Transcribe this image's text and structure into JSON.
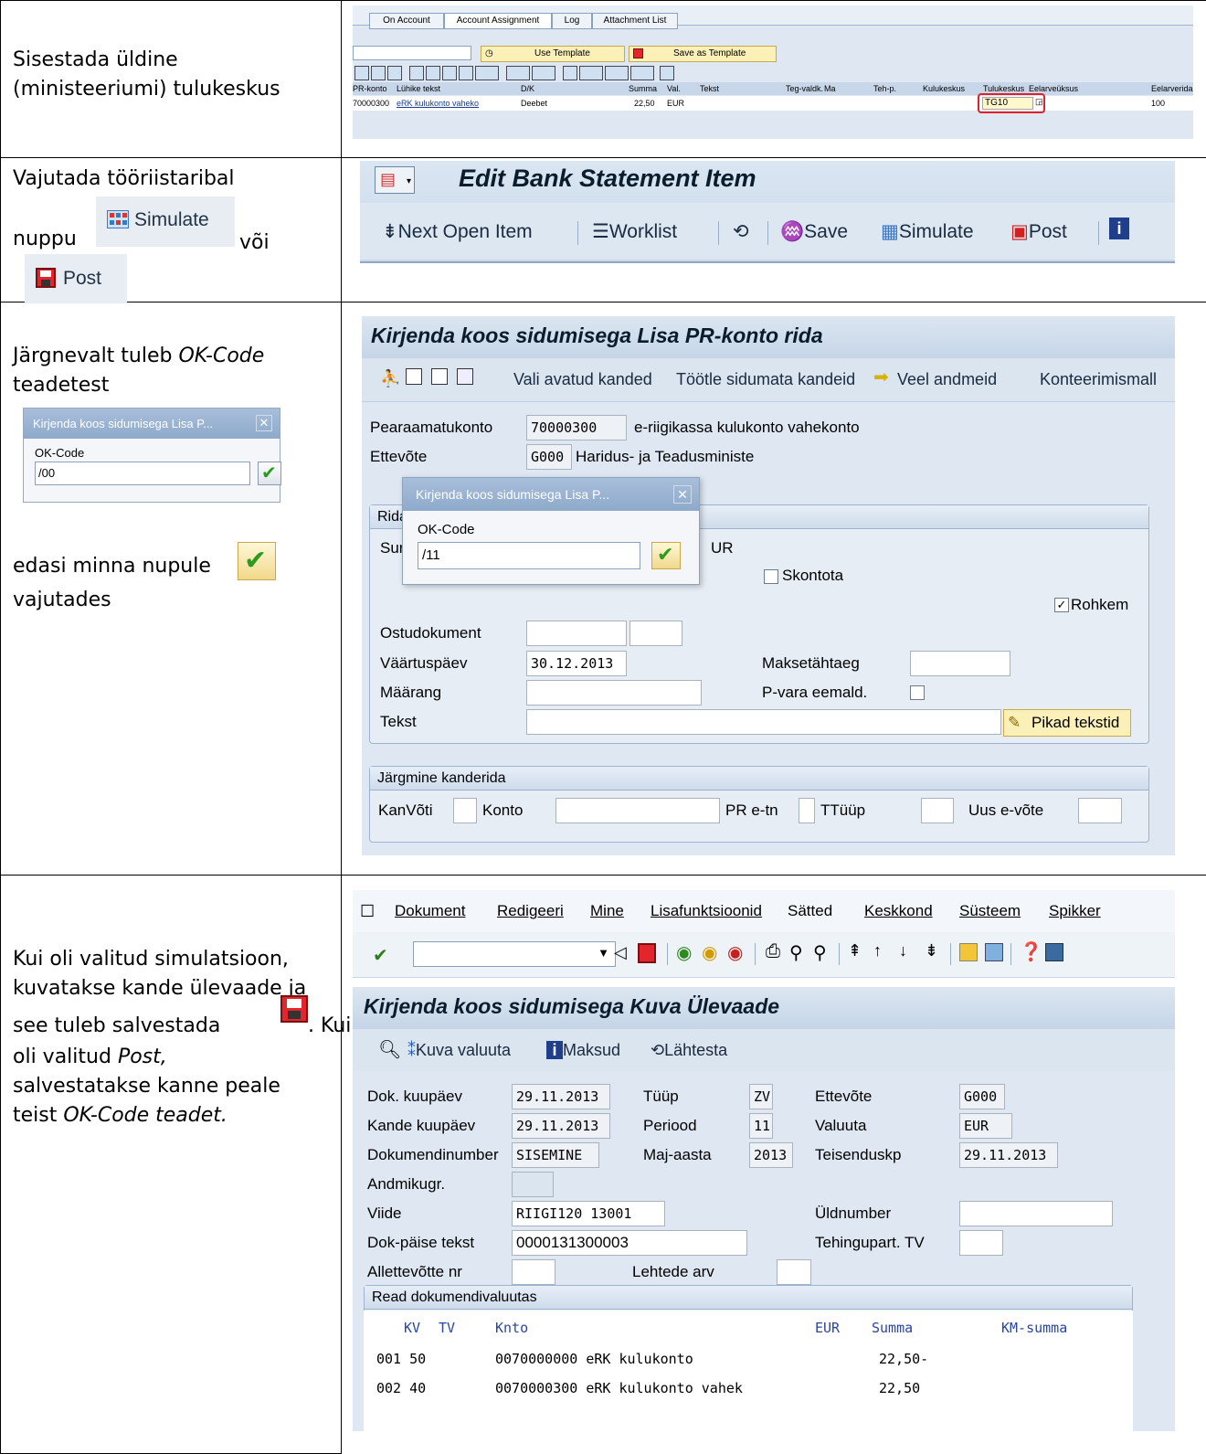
{
  "rows": [
    {
      "instruction": [
        "Sisestada üldine",
        "(ministeeriumi) tulukeskus"
      ]
    },
    {
      "instruction_parts": {
        "line1": "Vajutada tööriistaribal",
        "nuppu": "nuppu",
        "voi": "või",
        "simulate": "Simulate",
        "post": "Post"
      }
    },
    {
      "instruction_parts": {
        "p1": "Järgnevalt tuleb ",
        "okcode": "OK-Code",
        "p2": "teadetest",
        "p3": "edasi minna nupule",
        "p4": "vajutades"
      }
    },
    {
      "instruction_parts": {
        "l1": "Kui oli valitud simulatsioon,",
        "l2": "kuvatakse kande ülevaade ja",
        "l3a": "see tuleb salvestada",
        "l3b": ". Kui",
        "l4a": "oli valitud ",
        "l4b": "Post,",
        "l5": "salvestatakse kanne peale",
        "l6a": "teist ",
        "l6b": "OK-Code teadet."
      }
    }
  ],
  "screen1": {
    "tabs": [
      "On Account",
      "Account Assignment",
      "Log",
      "Attachment List"
    ],
    "use_template": "Use Template",
    "save_as_template": "Save as Template",
    "headers": [
      "PR-konto",
      "Lühike tekst",
      "D/K",
      "Summa",
      "Val.",
      "Tekst",
      "Teg-valdk.",
      "Ma",
      "Teh-p.",
      "Kulukeskus",
      "Tulukeskus",
      "Eelarveüksus",
      "Eelarverida"
    ],
    "row": {
      "konto": "70000300",
      "tekst": "eRK kulukonto vaheko",
      "dk": "Deebet",
      "summa": "22,50",
      "val": "EUR",
      "tulukeskus": "TG10",
      "eelarverida": "100"
    }
  },
  "screen2": {
    "title": "Edit Bank Statement Item",
    "buttons": [
      "Next Open Item",
      "Worklist",
      "Save",
      "Simulate",
      "Post"
    ]
  },
  "popup_small": {
    "title": "Kirjenda koos sidumisega Lisa P...",
    "label": "OK-Code",
    "value": "/00"
  },
  "screen3": {
    "title": "Kirjenda koos sidumisega Lisa PR-konto rida",
    "toolbar": [
      "Vali avatud kanded",
      "Töötle sidumata kandeid",
      "Veel andmeid",
      "Konteerimismall"
    ],
    "pearaamatukonto_label": "Pearaamatukonto",
    "pearaamatukonto_value": "70000300",
    "pearaamatukonto_text": "e-riigikassa kulukonto vahekonto",
    "ettevote_label": "Ettevõte",
    "ettevote_value": "G000",
    "ettevote_text": "Haridus- ja Teadusministe",
    "group_head_partial": "Rida",
    "sum_partial": "Sur",
    "cur_partial": "UR",
    "skontota": "Skontota",
    "rohkem": "Rohkem",
    "ostudokument": "Ostudokument",
    "vaartuspaev": "Väärtuspäev",
    "vaartuspaev_value": "30.12.2013",
    "maksetahtaeg": "Maksetähtaeg",
    "maarang": "Määrang",
    "pvara": "P-vara eemald.",
    "tekst": "Tekst",
    "pikad": "Pikad tekstid",
    "next_group": "Järgmine kanderida",
    "kanvoti": "KanVõti",
    "konto": "Konto",
    "pr_etn": "PR e-tn",
    "ttuup": "TTüüp",
    "uus": "Uus e-võte",
    "popup": {
      "title": "Kirjenda koos sidumisega Lisa P...",
      "label": "OK-Code",
      "value": "/11"
    }
  },
  "screen4": {
    "menu": [
      "Dokument",
      "Redigeeri",
      "Mine",
      "Lisafunktsioonid",
      "Sätted",
      "Keskkond",
      "Süsteem",
      "Spikker"
    ],
    "title": "Kirjenda koos sidumisega Kuva Ülevaade",
    "toolbar": [
      "Kuva valuuta",
      "Maksud",
      "Lähtesta"
    ],
    "fields": {
      "dok_kuupaev": "Dok. kuupäev",
      "dok_kuupaev_v": "29.11.2013",
      "tuup": "Tüüp",
      "tuup_v": "ZV",
      "ettevote": "Ettevõte",
      "ettevote_v": "G000",
      "kande_kuupaev": "Kande kuupäev",
      "kande_kuupaev_v": "29.11.2013",
      "periood": "Periood",
      "periood_v": "11",
      "valuuta": "Valuuta",
      "valuuta_v": "EUR",
      "dokumendinumber": "Dokumendinumber",
      "dokumendinumber_v": "SISEMINE",
      "maj_aasta": "Maj-aasta",
      "maj_aasta_v": "2013",
      "teisenduskp": "Teisenduskp",
      "teisenduskp_v": "29.11.2013",
      "andmikugr": "Andmikugr.",
      "viide": "Viide",
      "viide_v": "RIIGI120  13001",
      "uldnumber": "Üldnumber",
      "dok_paise": "Dok-päise tekst",
      "dok_paise_v": "0000131300003",
      "tehingupart": "Tehingupart. TV",
      "allettevotte": "Allettevõtte nr",
      "lehtede_arv": "Lehtede arv"
    },
    "group": "Read dokumendivaluutas",
    "table_head": [
      "KV",
      "TV",
      "Knto",
      "EUR",
      "Summa",
      "KM-summa"
    ],
    "table_rows": [
      {
        "a": "001 50",
        "b": "0070000000 eRK kulukonto",
        "c": "22,50-"
      },
      {
        "a": "002 40",
        "b": "0070000300 eRK kulukonto vahek",
        "c": "22,50"
      }
    ]
  }
}
